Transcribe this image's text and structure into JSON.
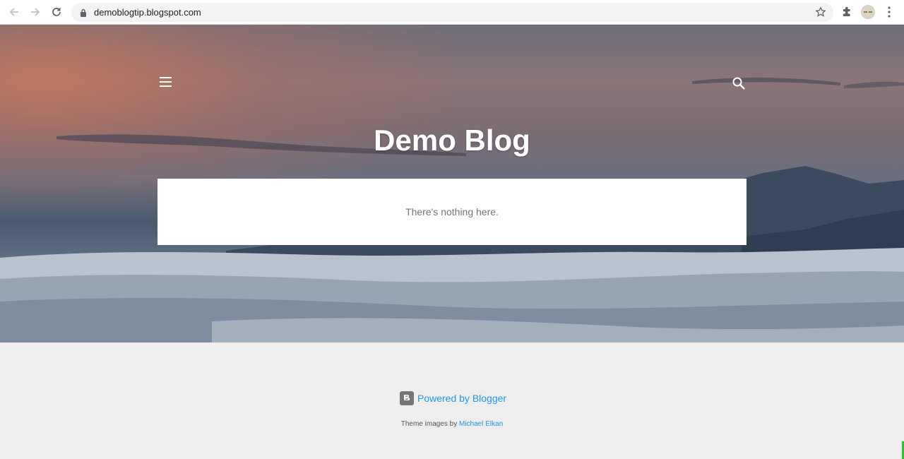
{
  "browser": {
    "url": "demoblogtip.blogspot.com",
    "icons": [
      "back-icon",
      "forward-icon",
      "reload-icon",
      "lock-icon",
      "star-icon",
      "extensions-icon",
      "profile-avatar",
      "menu-kebab-icon"
    ]
  },
  "header": {
    "title": "Demo Blog",
    "menu_icon": "hamburger-menu-icon",
    "search_icon": "search-icon"
  },
  "main": {
    "empty_message": "There's nothing here."
  },
  "footer": {
    "powered_label": "Powered by Blogger",
    "theme_prefix": "Theme images by",
    "theme_author": "Michael Elkan"
  },
  "colors": {
    "link": "#2196f3",
    "footer_bg": "#eeeeee",
    "card_bg": "#ffffff",
    "title": "#ffffff"
  }
}
